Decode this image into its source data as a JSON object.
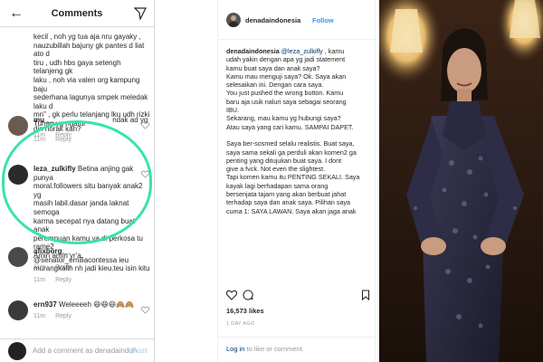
{
  "comments_panel": {
    "title": "Comments",
    "comments": [
      {
        "lines": [
          "kecil , noh yg tua aja nru gayaky ,",
          "nauzubillah bajuny gk pantes d liat ato d",
          "tiru , udh hbs gaya setengh telanjeng gk",
          "laku , noh via valen org kampung baju",
          "sederhana lagunya smpek meledak laku d",
          "mn\" , gk perlu telanjang lku udh rizki",
          "Tuhan yg ngatur"
        ],
        "time": "11m",
        "reply": "Reply"
      },
      {
        "user": "mu___________",
        "lines": [
          "ndak ad yg",
          "din norak kah?"
        ],
        "time": "11m",
        "reply": "Reply"
      },
      {
        "user": "leza_zulkifly",
        "lines": [
          "Betina anjing gak punya",
          "moral.followers situ banyak anak2 yg",
          "masih labil.dasar janda laknat semoga",
          "karma secepat nya datang buat anak",
          "perempuan kamu ya di perkosa tu rame2",
          "Amin amin yr'a."
        ],
        "time": "11m",
        "reply": "Reply"
      },
      {
        "user": "afixborg__",
        "lines": [
          "@senator_emiliacontessa ieu",
          "murangkalih nh jadi kieu.teu isin kitu"
        ],
        "time": "11m",
        "reply": "Reply"
      },
      {
        "user": "ern937",
        "lines": [
          "Weleeeeh 😆😆😆🙈🙈"
        ],
        "time": "11m",
        "reply": "Reply"
      }
    ],
    "input_placeholder": "Add a comment as denadaindon...",
    "post_label": "Post"
  },
  "post": {
    "username": "denadaindonesia",
    "follow_label": "Follow",
    "caption": {
      "mention": "@leza_zulkifly",
      "first_line_rest": " , kamu",
      "lines": [
        "udah yakin dengan apa yg jadi statement",
        "kamu buat saya dan anak saya?",
        "Kamu mau menguji saya? Ok. Saya akan",
        "selesaikan ini. Dengan cara saya.",
        "You just pushed the wrong button. Kamu",
        "baru aja usik naluri saya sebagai seorang",
        "IBU.",
        "Sekarang, mau kamu yg hubungi saya?",
        "Atau saya yang cari kamu. SAMPAI DAPET.",
        "",
        "Saya ber-sosmed selalu realistis. Buat saya,",
        "saya sama sekali ga perduli akan komen2 ga",
        "penting yang ditujukan buat saya. I dont",
        "give a fvck. Not even the slightest.",
        "Tapi komen kamu itu PENTING SEKALI. Saya",
        "kayak lagi berhadapan sama orang",
        "bersenjata tajam yang akan berbuat jahat",
        "terhadap saya dan anak saya. Pilihan saya",
        "cuma 1: SAYA LAWAN. Saya akan jaga anak"
      ]
    },
    "likes": "16,573 likes",
    "time_ago": "1 DAY AGO",
    "login_link": "Log in",
    "login_rest": " to like or comment."
  },
  "colors": {
    "highlight": "#39e2b0",
    "link": "#003569",
    "follow": "#3897f0"
  }
}
